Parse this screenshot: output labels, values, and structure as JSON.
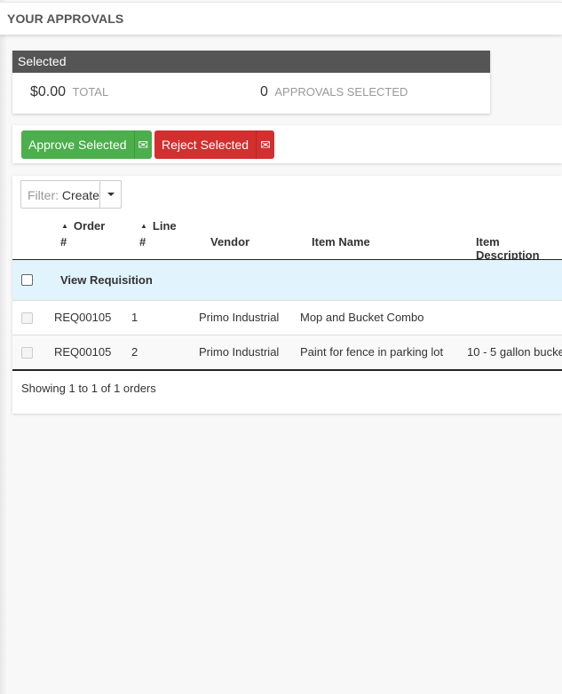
{
  "header": {
    "title": "YOUR APPROVALS"
  },
  "selected_panel": {
    "title": "Selected",
    "total_value": "$0.00",
    "total_label": "TOTAL",
    "count_value": "0",
    "count_label": "APPROVALS SELECTED"
  },
  "actions": {
    "approve_label": "Approve Selected",
    "approve_icon": "envelope-icon",
    "reject_label": "Reject Selected",
    "reject_icon": "envelope-icon",
    "approve_color": "#4cae4c",
    "reject_color": "#d32f2f"
  },
  "filter": {
    "prefix": "Filter:",
    "value": "Create"
  },
  "table": {
    "columns": [
      {
        "label": "Order",
        "sub": "#",
        "sortable": true
      },
      {
        "label": "Line",
        "sub": "#",
        "sortable": true
      },
      {
        "label": "Vendor"
      },
      {
        "label": "Item Name"
      },
      {
        "label": "Item Description"
      }
    ],
    "group_label": "View Requisition",
    "rows": [
      {
        "order": "REQ00105",
        "line": "1",
        "vendor": "Primo Industrial",
        "item_name": "Mop and Bucket Combo",
        "item_description": ""
      },
      {
        "order": "REQ00105",
        "line": "2",
        "vendor": "Primo Industrial",
        "item_name": "Paint for fence in parking lot",
        "item_description": "10 - 5 gallon bucke"
      }
    ],
    "footer": "Showing 1 to 1 of 1 orders"
  }
}
